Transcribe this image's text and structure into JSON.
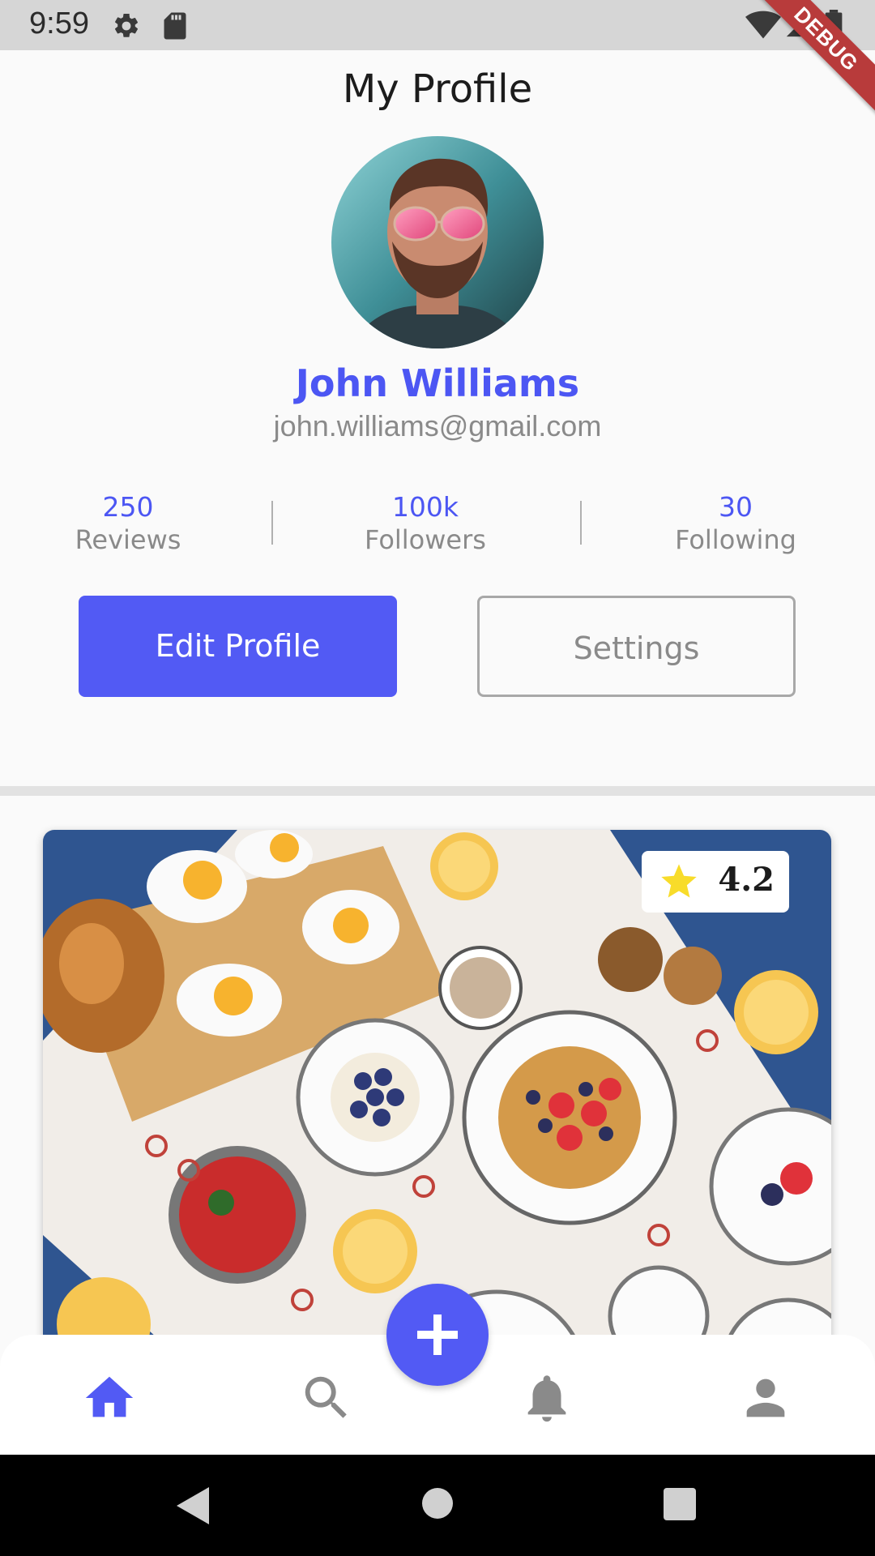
{
  "status_bar": {
    "time": "9:59",
    "icons": [
      "settings-icon",
      "sd-card-icon",
      "wifi-icon",
      "signal-icon",
      "battery-icon"
    ],
    "debug_label": "DEBUG"
  },
  "header": {
    "title": "My Profile"
  },
  "profile": {
    "name": "John Williams",
    "email": "john.williams@gmail.com",
    "avatar_icon": "profile-photo"
  },
  "stats": [
    {
      "value": "250",
      "label": "Reviews"
    },
    {
      "value": "100k",
      "label": "Followers"
    },
    {
      "value": "30",
      "label": "Following"
    }
  ],
  "actions": {
    "edit_label": "Edit Profile",
    "settings_label": "Settings"
  },
  "post": {
    "rating": "4.2",
    "rating_icon": "star-icon"
  },
  "bottom_nav": {
    "items": [
      "home-icon",
      "search-icon",
      "add-icon",
      "bell-icon",
      "person-icon"
    ],
    "active": "home-icon"
  },
  "system_nav": {
    "items": [
      "back-icon",
      "home-circle-icon",
      "recents-icon"
    ]
  },
  "colors": {
    "accent": "#525af4",
    "accent_text": "#4c56f3",
    "muted_text": "#8a8a8a",
    "debug_banner": "#b83b3b",
    "star": "#f8dc2a"
  }
}
